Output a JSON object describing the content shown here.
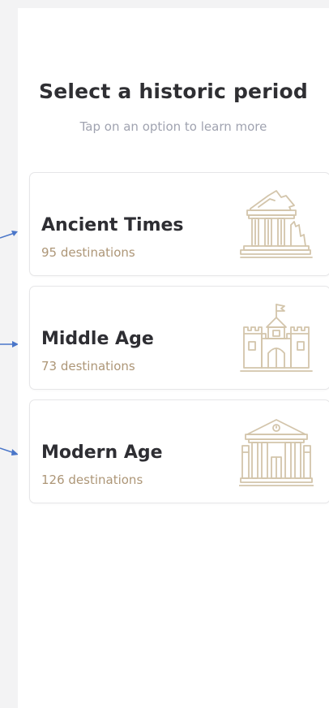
{
  "header": {
    "title": "Select a historic period",
    "subtitle": "Tap on an option to learn more"
  },
  "periods": [
    {
      "label": "Ancient Times",
      "count": "95 destinations",
      "icon": "ancient-temple-icon"
    },
    {
      "label": "Middle Age",
      "count": "73 destinations",
      "icon": "castle-icon"
    },
    {
      "label": "Modern Age",
      "count": "126 destinations",
      "icon": "government-building-icon"
    }
  ],
  "colors": {
    "icon_stroke": "#d3c5ab",
    "count_text": "#ad9677",
    "arrow": "#4a76c9"
  }
}
